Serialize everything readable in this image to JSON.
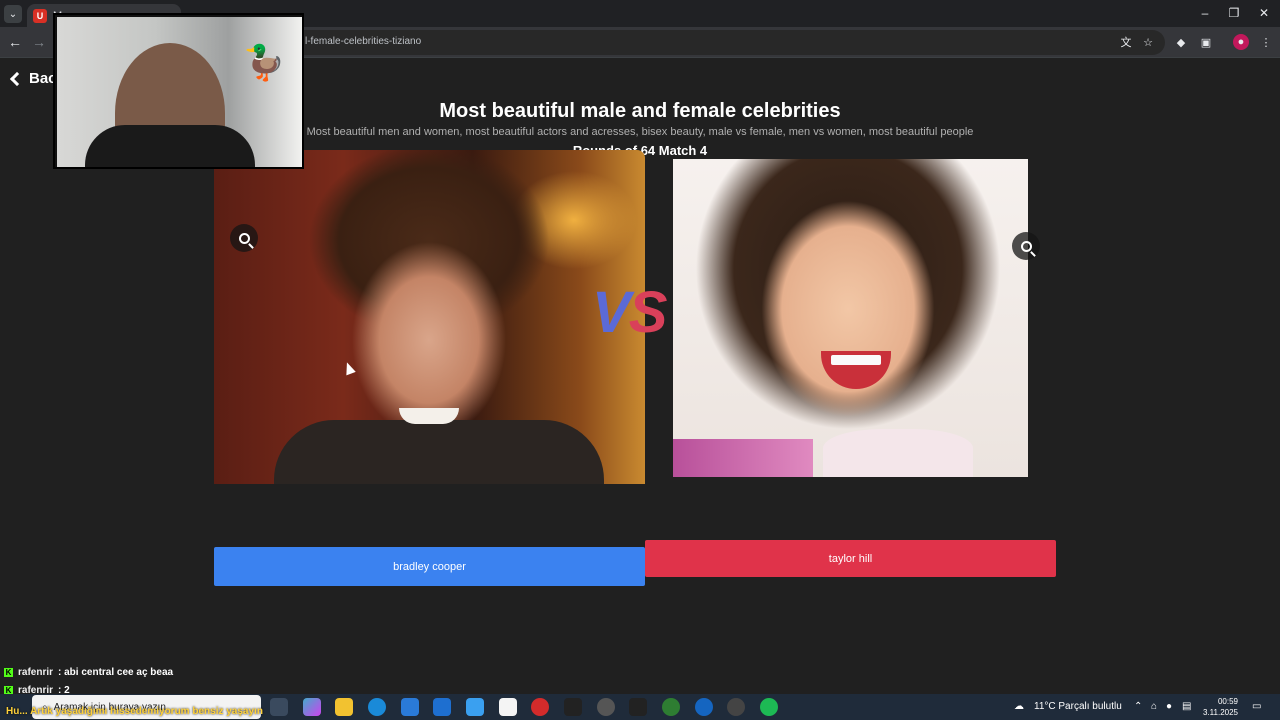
{
  "browser": {
    "tab_title": "M",
    "tab_favicon": "U",
    "url": "l-female-celebrities-tiziano",
    "icons": [
      "search-tabs-icon",
      "back-icon",
      "forward-icon",
      "translate-icon",
      "star-icon",
      "extension-icon",
      "profile-icon",
      "menu-icon"
    ]
  },
  "page": {
    "back_label": "Bac",
    "title": "Most beautiful male and female celebrities",
    "subtitle": "Most beautiful men and women, most beautiful actors and acresses, bisex beauty, male vs female, men vs women, most beautiful people",
    "round_info": "Rounds of 64 Match 4",
    "vs_v": "V",
    "vs_s": "S",
    "left_candidate": {
      "name": "bradley cooper",
      "color": "#3b82f0"
    },
    "right_candidate": {
      "name": "taylor hill",
      "color": "#e0334a"
    }
  },
  "chat": [
    {
      "user": "rafenrir",
      "message": ": abi central cee aç beaa"
    },
    {
      "user": "rafenrir",
      "message": ": 2"
    }
  ],
  "taskbar": {
    "search_text": "Aramak için buraya yazın",
    "ticker": "Hu... Artık yaşadığımı hissedemiyorum bensiz yaşayın",
    "weather": "11°C  Parçalı bulutlu",
    "time": "00:59",
    "date": "3.11.2025"
  }
}
